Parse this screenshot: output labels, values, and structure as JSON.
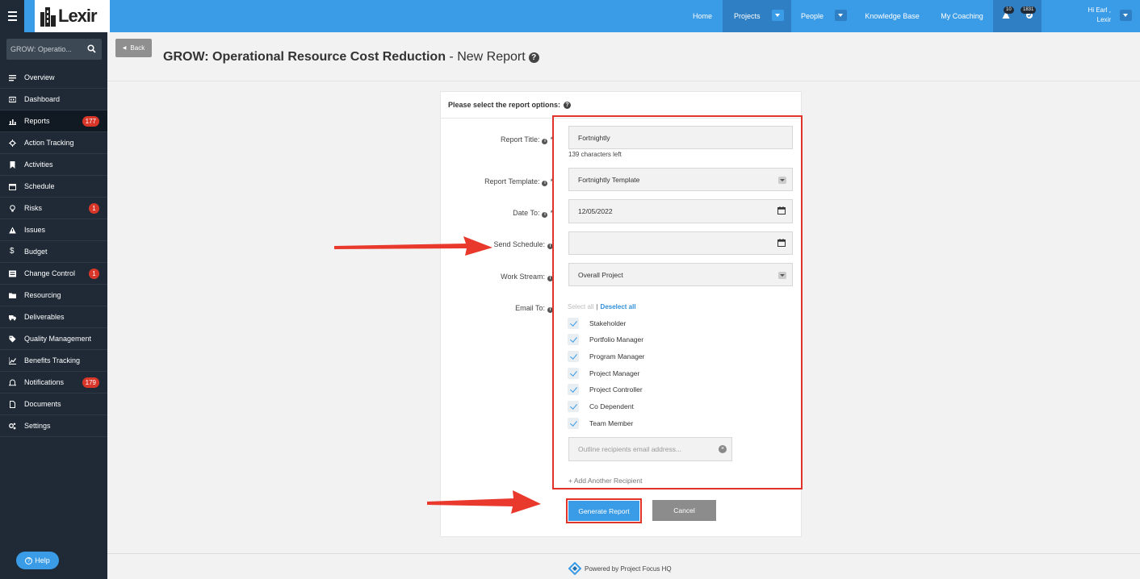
{
  "topbar": {
    "logo_text": "Lexir",
    "nav": [
      {
        "label": "Home"
      },
      {
        "label": "Projects"
      },
      {
        "label": "People"
      },
      {
        "label": "Knowledge Base"
      },
      {
        "label": "My Coaching"
      }
    ],
    "alerts_count": "10",
    "tasks_count": "1831",
    "user_greeting": "Hi Earl ,",
    "user_name": "Lexir",
    "brand_color": "#3a9be6"
  },
  "sidebar": {
    "search_text": "GROW: Operatio...",
    "items": [
      {
        "label": "Overview",
        "icon": "list-icon"
      },
      {
        "label": "Dashboard",
        "icon": "dashboard-icon"
      },
      {
        "label": "Reports",
        "icon": "bar-chart-icon",
        "badge": "177"
      },
      {
        "label": "Action Tracking",
        "icon": "crosshair-icon"
      },
      {
        "label": "Activities",
        "icon": "bookmark-icon"
      },
      {
        "label": "Schedule",
        "icon": "calendar-icon"
      },
      {
        "label": "Risks",
        "icon": "lightbulb-icon",
        "badge": "1"
      },
      {
        "label": "Issues",
        "icon": "warning-icon"
      },
      {
        "label": "Budget",
        "icon": "dollar-icon"
      },
      {
        "label": "Change Control",
        "icon": "change-icon",
        "badge": "1"
      },
      {
        "label": "Resourcing",
        "icon": "folder-icon"
      },
      {
        "label": "Deliverables",
        "icon": "truck-icon"
      },
      {
        "label": "Quality Management",
        "icon": "tag-icon"
      },
      {
        "label": "Benefits Tracking",
        "icon": "line-chart-icon"
      },
      {
        "label": "Notifications",
        "icon": "bell-icon",
        "badge": "179"
      },
      {
        "label": "Documents",
        "icon": "document-icon"
      },
      {
        "label": "Settings",
        "icon": "cogs-icon"
      }
    ],
    "help_label": "Help"
  },
  "header": {
    "back_label": "Back",
    "title_bold": "GROW: Operational Resource Cost Reduction",
    "title_rest": " - New Report"
  },
  "form": {
    "heading": "Please select the report options:",
    "report_title_label": "Report Title:",
    "report_title_value": "Fortnightly",
    "chars_left": "139 characters left",
    "template_label": "Report Template:",
    "template_value": "Fortnightly Template",
    "date_to_label": "Date To:",
    "date_to_value": "12/05/2022",
    "send_schedule_label": "Send Schedule:",
    "send_schedule_value": "",
    "work_stream_label": "Work Stream:",
    "work_stream_value": "Overall Project",
    "email_to_label": "Email To:",
    "select_all": "Select all",
    "deselect_all": "Deselect all",
    "recipients": [
      {
        "label": "Stakeholder",
        "checked": true
      },
      {
        "label": "Portfolio Manager",
        "checked": true
      },
      {
        "label": "Program Manager",
        "checked": true
      },
      {
        "label": "Project Manager",
        "checked": true
      },
      {
        "label": "Project Controller",
        "checked": true
      },
      {
        "label": "Co Dependent",
        "checked": true
      },
      {
        "label": "Team Member",
        "checked": true
      }
    ],
    "email_placeholder": "Outline recipients email address...",
    "add_recipient": "+ Add Another Recipient",
    "generate_label": "Generate Report",
    "cancel_label": "Cancel"
  },
  "footer": {
    "text": "Powered by Project Focus HQ"
  },
  "annotation_color": "#e0332a"
}
